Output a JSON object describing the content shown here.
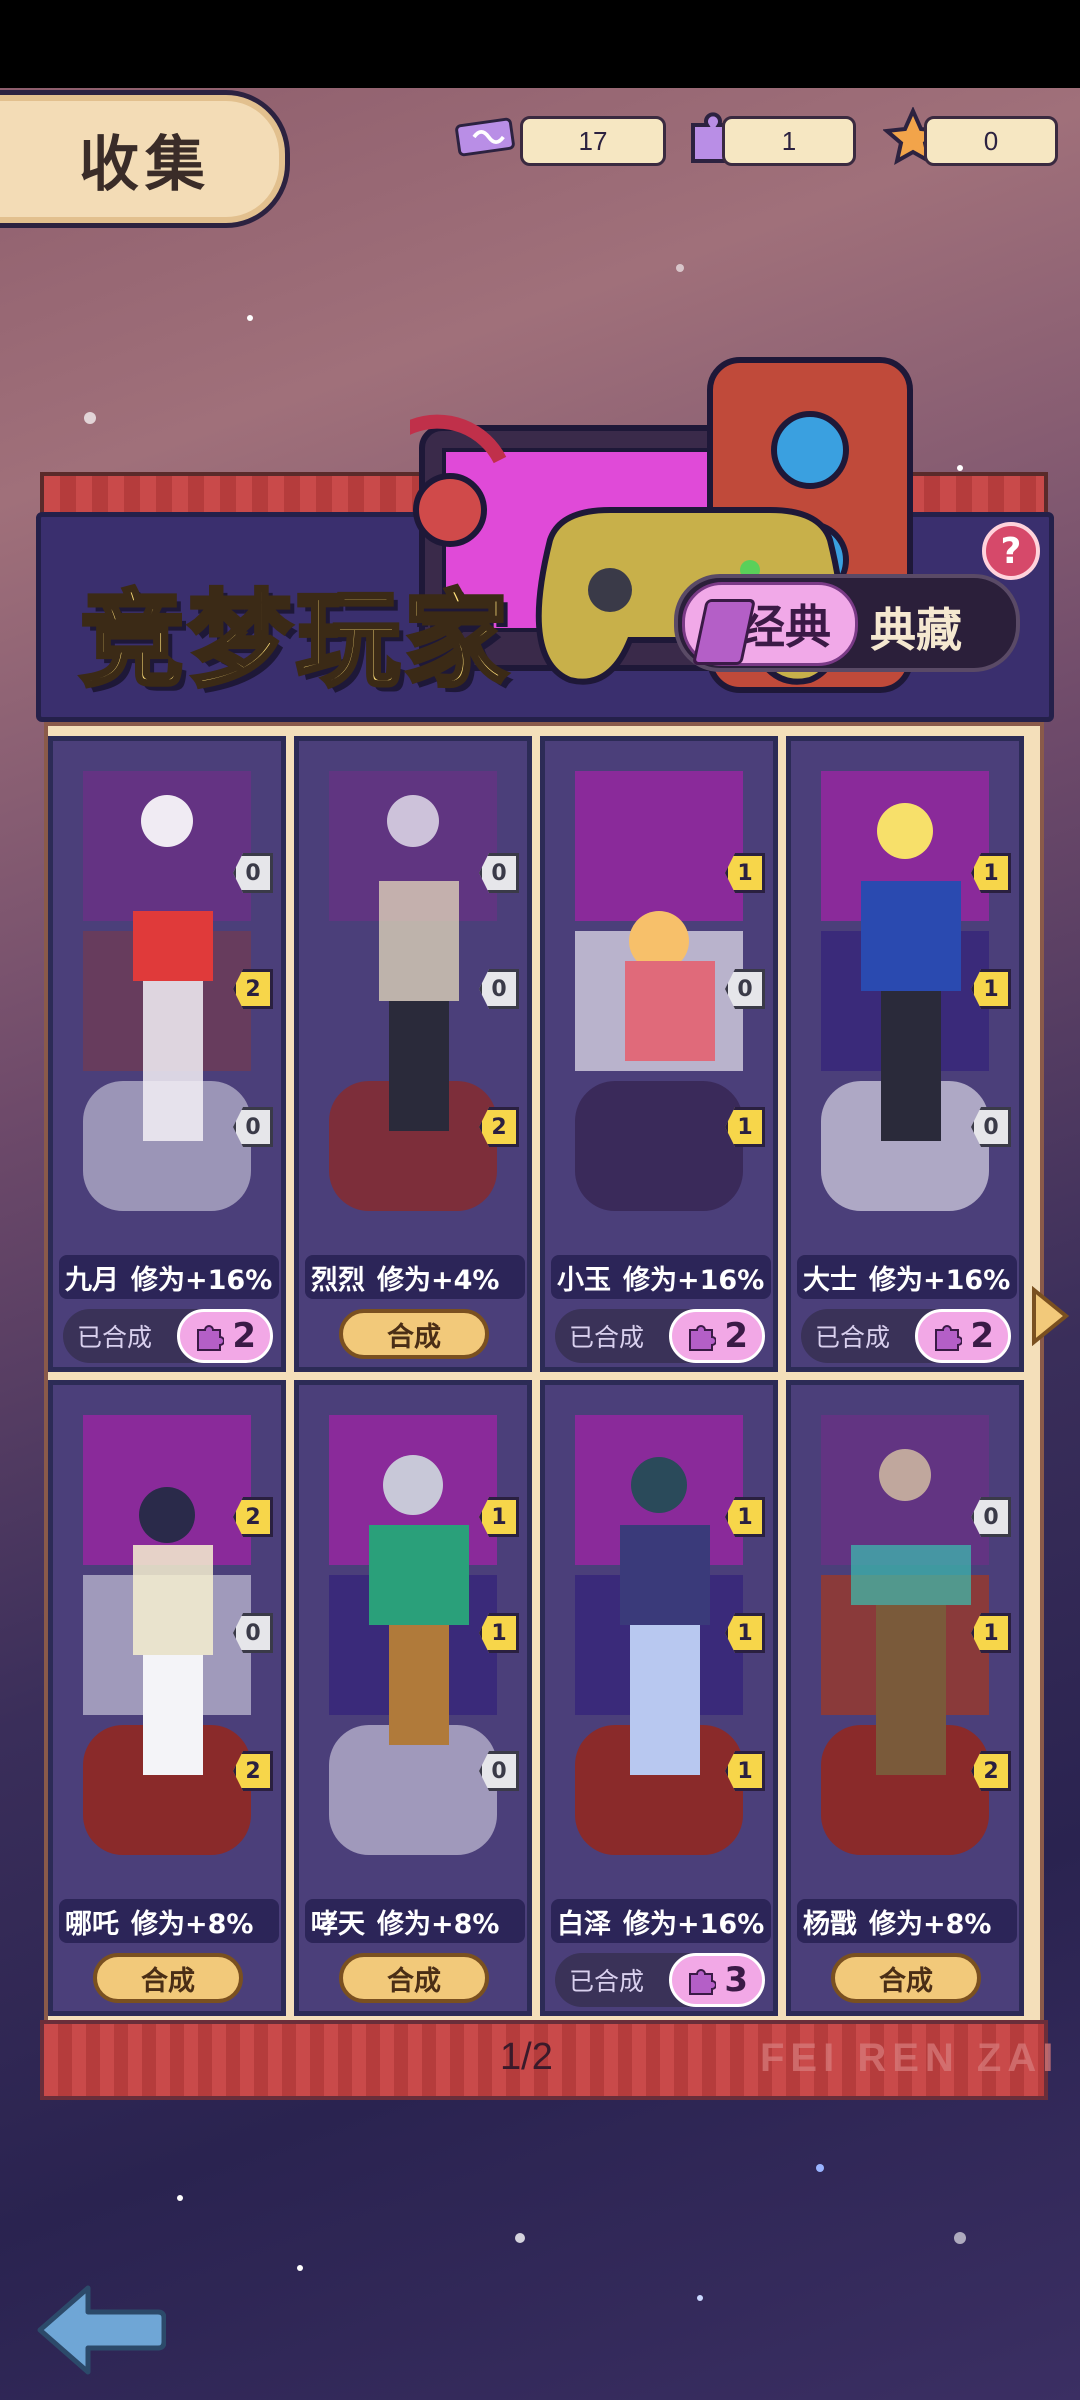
{
  "collect_tab": {
    "label": "收集"
  },
  "resources": [
    {
      "icon": "ticket-icon",
      "value": "17"
    },
    {
      "icon": "puzzle-piece-icon",
      "value": "1"
    },
    {
      "icon": "star-piece-icon",
      "value": "0"
    }
  ],
  "header": {
    "title": "竞梦玩家",
    "toggle_on": "经典",
    "toggle_off": "典藏",
    "help": "?"
  },
  "colors": {
    "accent": "#f7d64a",
    "panel": "#4b3f7a",
    "pink": "#f2a8e6"
  },
  "cards": [
    {
      "name": "九月",
      "bonus": "修为+16%",
      "badges": [
        "0",
        "2",
        "0"
      ],
      "state": "merged",
      "merged_label": "已合成",
      "count": "2"
    },
    {
      "name": "烈烈",
      "bonus": "修为+4%",
      "badges": [
        "0",
        "0",
        "2"
      ],
      "state": "merge",
      "button": "合成"
    },
    {
      "name": "小玉",
      "bonus": "修为+16%",
      "badges": [
        "1",
        "0",
        "1"
      ],
      "state": "merged",
      "merged_label": "已合成",
      "count": "2"
    },
    {
      "name": "大士",
      "bonus": "修为+16%",
      "badges": [
        "1",
        "1",
        "0"
      ],
      "state": "merged",
      "merged_label": "已合成",
      "count": "2"
    },
    {
      "name": "哪吒",
      "bonus": "修为+8%",
      "badges": [
        "2",
        "0",
        "2"
      ],
      "state": "merge",
      "button": "合成"
    },
    {
      "name": "哮天",
      "bonus": "修为+8%",
      "badges": [
        "1",
        "1",
        "0"
      ],
      "state": "merge",
      "button": "合成"
    },
    {
      "name": "白泽",
      "bonus": "修为+16%",
      "badges": [
        "1",
        "1",
        "1"
      ],
      "state": "merged",
      "merged_label": "已合成",
      "count": "3"
    },
    {
      "name": "杨戬",
      "bonus": "修为+8%",
      "badges": [
        "0",
        "1",
        "2"
      ],
      "state": "merge",
      "button": "合成"
    }
  ],
  "pagination": {
    "text": "1/2"
  },
  "footer_brand": "FEI REN ZAI"
}
